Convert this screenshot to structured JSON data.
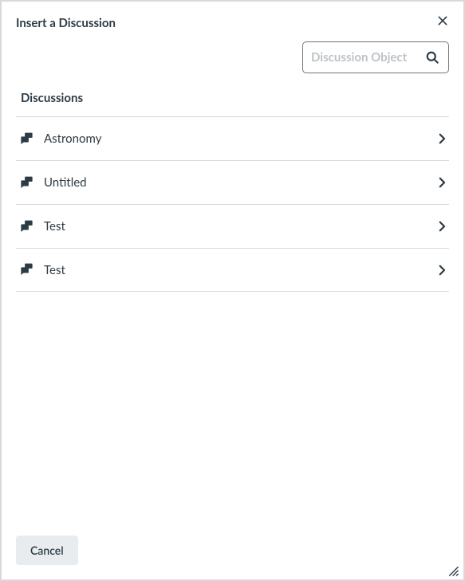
{
  "header": {
    "title": "Insert a Discussion"
  },
  "search": {
    "placeholder": "Discussion Object"
  },
  "section": {
    "title": "Discussions"
  },
  "items": [
    {
      "label": "Astronomy"
    },
    {
      "label": "Untitled"
    },
    {
      "label": "Test"
    },
    {
      "label": "Test"
    }
  ],
  "footer": {
    "cancel": "Cancel"
  }
}
